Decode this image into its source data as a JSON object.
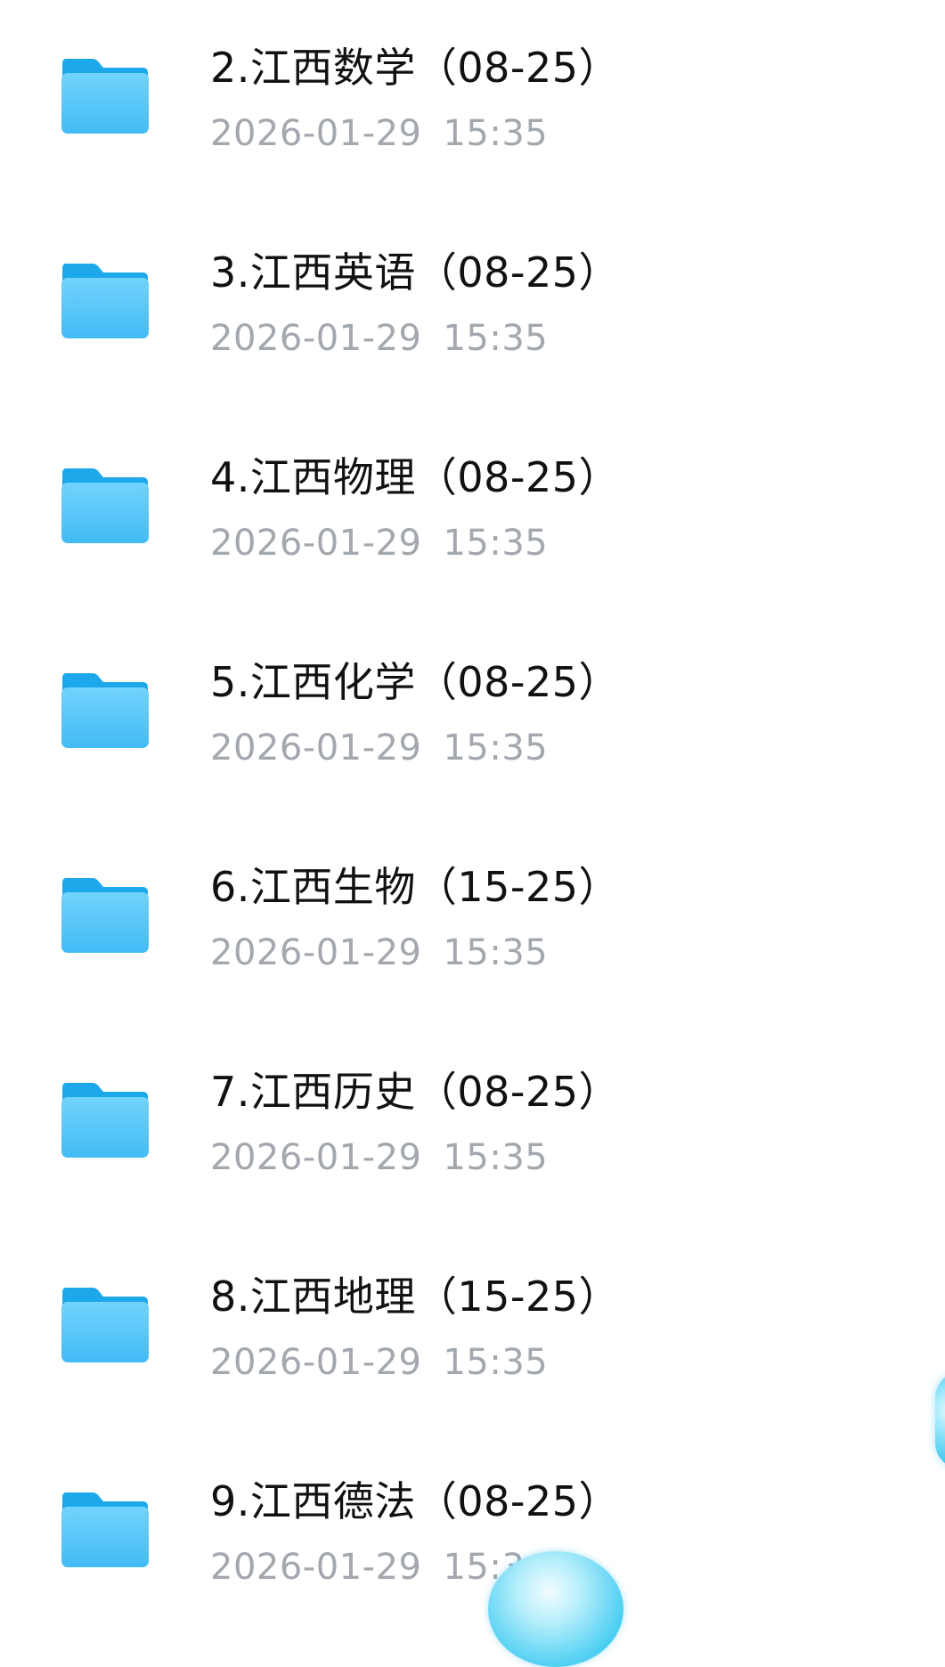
{
  "files": [
    {
      "name": "2.江西数学（08-25）",
      "date": "2026-01-29",
      "time": "15:35",
      "icon": "folder-icon"
    },
    {
      "name": "3.江西英语（08-25）",
      "date": "2026-01-29",
      "time": "15:35",
      "icon": "folder-icon"
    },
    {
      "name": "4.江西物理（08-25）",
      "date": "2026-01-29",
      "time": "15:35",
      "icon": "folder-icon"
    },
    {
      "name": "5.江西化学（08-25）",
      "date": "2026-01-29",
      "time": "15:35",
      "icon": "folder-icon"
    },
    {
      "name": "6.江西生物（15-25）",
      "date": "2026-01-29",
      "time": "15:35",
      "icon": "folder-icon"
    },
    {
      "name": "7.江西历史（08-25）",
      "date": "2026-01-29",
      "time": "15:35",
      "icon": "folder-icon"
    },
    {
      "name": "8.江西地理（15-25）",
      "date": "2026-01-29",
      "time": "15:35",
      "icon": "folder-icon"
    },
    {
      "name": "9.江西德法（08-25）",
      "date": "2026-01-29",
      "time": "15:3",
      "icon": "folder-icon"
    }
  ],
  "colors": {
    "folder_back": "#1ea8ec",
    "folder_front_top": "#6fd0fb",
    "folder_front_bottom": "#45bdf6",
    "title_text": "#111111",
    "date_text": "#a3a8ae"
  }
}
